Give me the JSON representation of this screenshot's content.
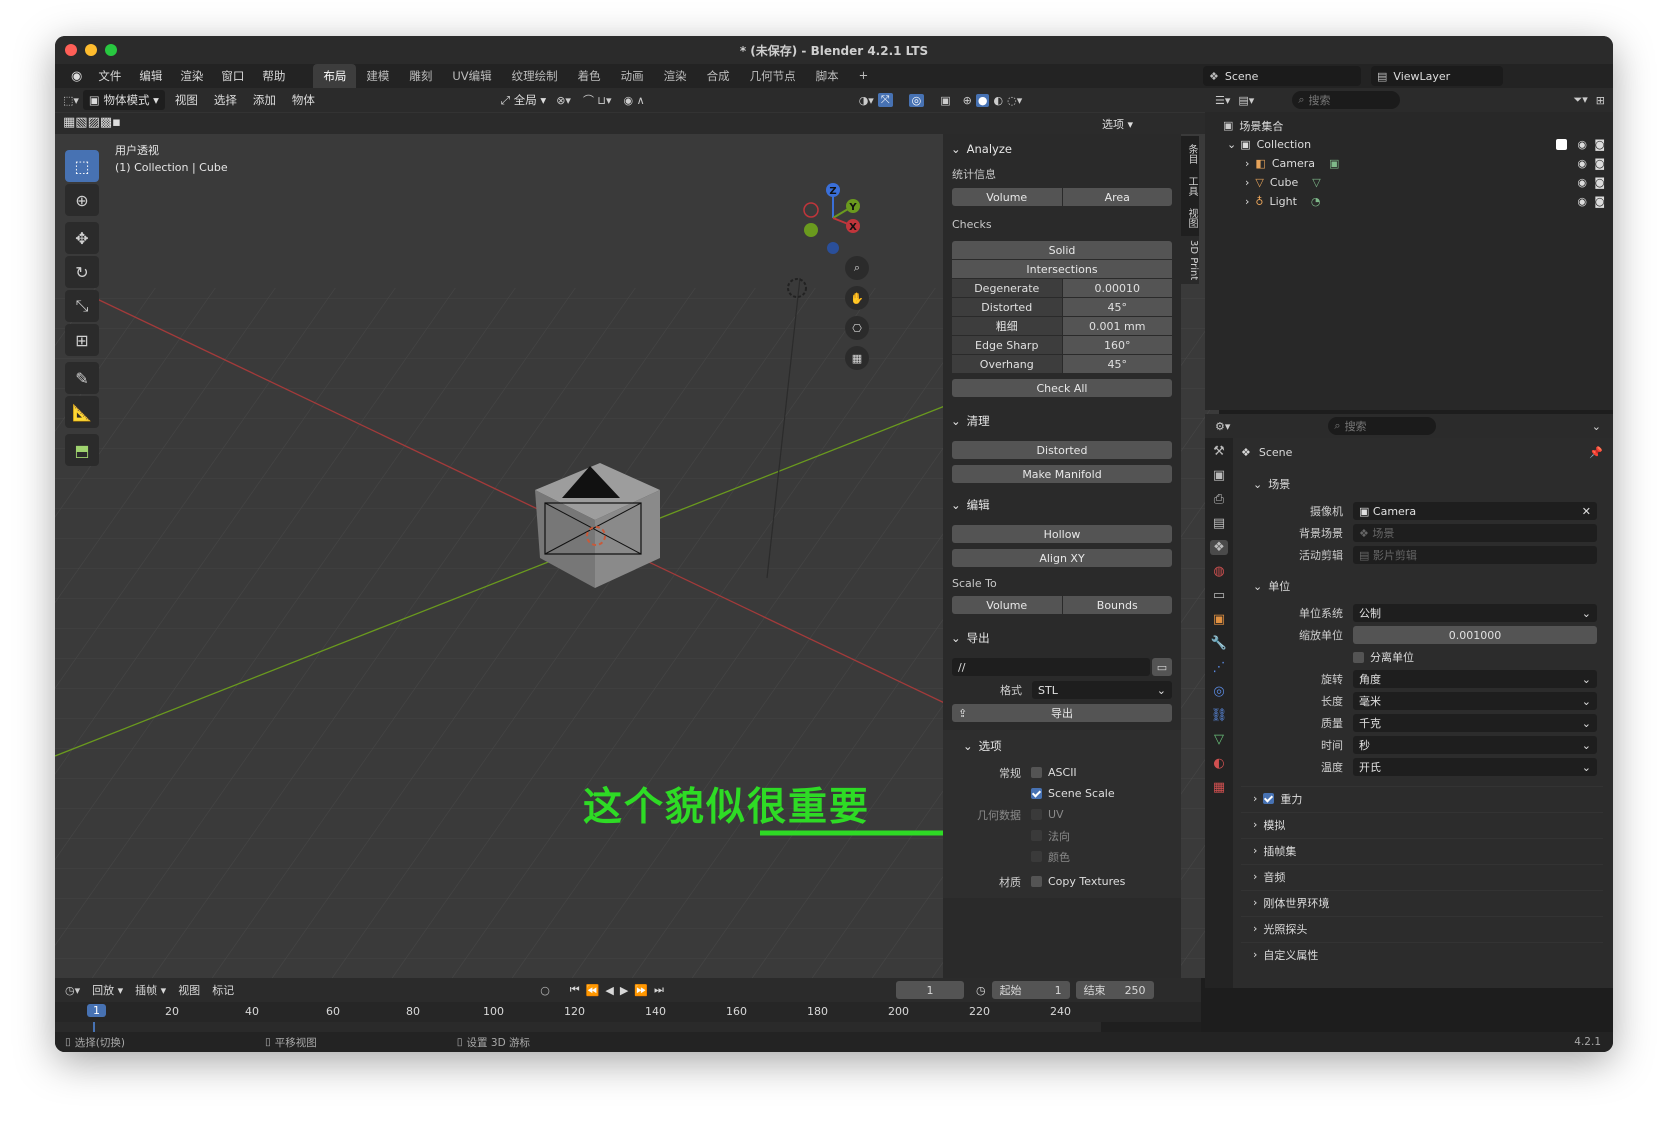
{
  "window": {
    "title": "* (未保存) - Blender 4.2.1 LTS"
  },
  "menu": [
    "文件",
    "编辑",
    "渲染",
    "窗口",
    "帮助"
  ],
  "workspace_tabs": [
    "布局",
    "建模",
    "雕刻",
    "UV编辑",
    "纹理绘制",
    "着色",
    "动画",
    "渲染",
    "合成",
    "几何节点",
    "脚本",
    "+"
  ],
  "active_tab": "布局",
  "scene": {
    "name": "Scene",
    "view_layer": "ViewLayer"
  },
  "viewport_header": {
    "mode": "物体模式",
    "items": [
      "视图",
      "选择",
      "添加",
      "物体"
    ],
    "transform": "全局",
    "options": "选项"
  },
  "viewport_overlay": {
    "view_name": "用户透视",
    "context": "(1) Collection | Cube"
  },
  "gizmo": {
    "z": "Z",
    "y": "Y",
    "x": "X"
  },
  "annotation": {
    "text": "这个貌似很重要",
    "color": "#2edb25"
  },
  "npanel": {
    "analyze": {
      "title": "Analyze",
      "stats_label": "统计信息",
      "stats_buttons": [
        "Volume",
        "Area"
      ],
      "checks_label": "Checks",
      "check_solid": "Solid",
      "check_intersections": "Intersections",
      "checks": [
        {
          "label": "Degenerate",
          "value": "0.00010"
        },
        {
          "label": "Distorted",
          "value": "45°"
        },
        {
          "label": "粗细",
          "value": "0.001 mm"
        },
        {
          "label": "Edge Sharp",
          "value": "160°"
        },
        {
          "label": "Overhang",
          "value": "45°"
        }
      ],
      "check_all": "Check All"
    },
    "cleanup": {
      "title": "清理",
      "distorted": "Distorted",
      "make_manifold": "Make Manifold"
    },
    "edit": {
      "title": "编辑",
      "hollow": "Hollow",
      "align_xy": "Align XY",
      "scale_to_label": "Scale To",
      "scale_to": [
        "Volume",
        "Bounds"
      ]
    },
    "export": {
      "title": "导出",
      "path": "//",
      "format_label": "格式",
      "format_value": "STL",
      "export_button": "导出",
      "options_title": "选项",
      "general_label": "常规",
      "ascii_label": "ASCII",
      "scene_scale_label": "Scene Scale",
      "geometry_label": "几何数据",
      "uv_label": "UV",
      "normal_label": "法向",
      "color_label": "颜色",
      "material_label": "材质",
      "copy_textures_label": "Copy Textures"
    }
  },
  "side_tabs": [
    "条目",
    "工具",
    "视图",
    "3D Print"
  ],
  "outliner": {
    "search_placeholder": "搜索",
    "root": "场景集合",
    "collection": "Collection",
    "objects": [
      "Camera",
      "Cube",
      "Light"
    ]
  },
  "properties": {
    "search_placeholder": "搜索",
    "breadcrumb": "Scene",
    "scene_section": "场景",
    "camera_label": "摄像机",
    "camera_value": "Camera",
    "background_label": "背景场景",
    "background_placeholder": "场景",
    "clip_label": "活动剪辑",
    "clip_placeholder": "影片剪辑",
    "units_section": "单位",
    "unit_system_label": "单位系统",
    "unit_system_value": "公制",
    "unit_scale_label": "缩放单位",
    "unit_scale_value": "0.001000",
    "separate_units_label": "分离单位",
    "rotation_label": "旋转",
    "rotation_value": "角度",
    "length_label": "长度",
    "length_value": "毫米",
    "mass_label": "质量",
    "mass_value": "千克",
    "time_label": "时间",
    "time_value": "秒",
    "temp_label": "温度",
    "temp_value": "开氏",
    "collapsed": [
      "重力",
      "模拟",
      "插帧集",
      "音频",
      "刚体世界环境",
      "光照探头",
      "自定义属性"
    ]
  },
  "timeline": {
    "menus": [
      "回放",
      "插帧",
      "视图",
      "标记"
    ],
    "current_frame": "1",
    "start_label": "起始",
    "start_value": "1",
    "end_label": "结束",
    "end_value": "250",
    "ruler": [
      "1",
      "20",
      "40",
      "60",
      "80",
      "100",
      "120",
      "140",
      "160",
      "180",
      "200",
      "220",
      "240"
    ]
  },
  "statusbar": {
    "select": "选择(切换)",
    "pan": "平移视图",
    "cursor": "设置 3D 游标",
    "version": "4.2.1"
  }
}
